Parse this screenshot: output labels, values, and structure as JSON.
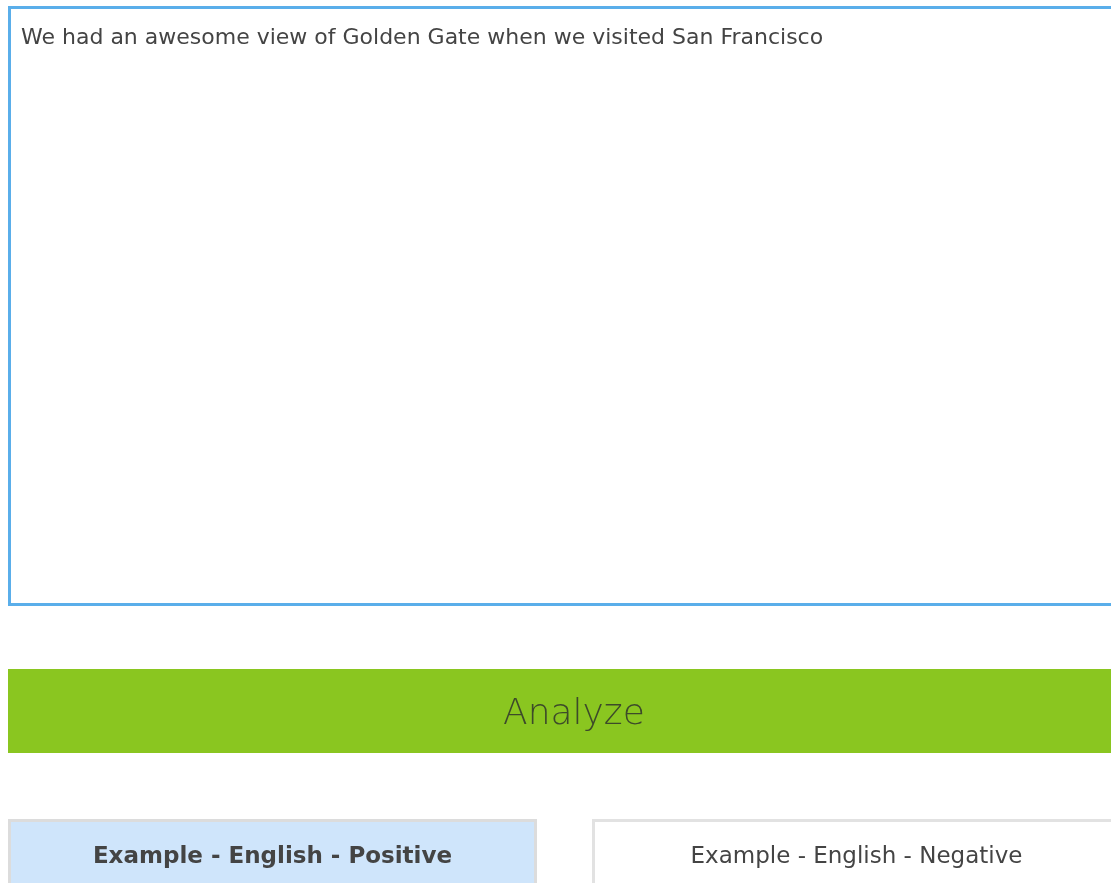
{
  "input": {
    "value": "We had an awesome view of Golden Gate when we visited San Francisco"
  },
  "analyze_button": {
    "label": "Analyze"
  },
  "examples": [
    {
      "label": "Example - English - Positive",
      "selected": true
    },
    {
      "label": "Example - English - Negative",
      "selected": false
    }
  ]
}
